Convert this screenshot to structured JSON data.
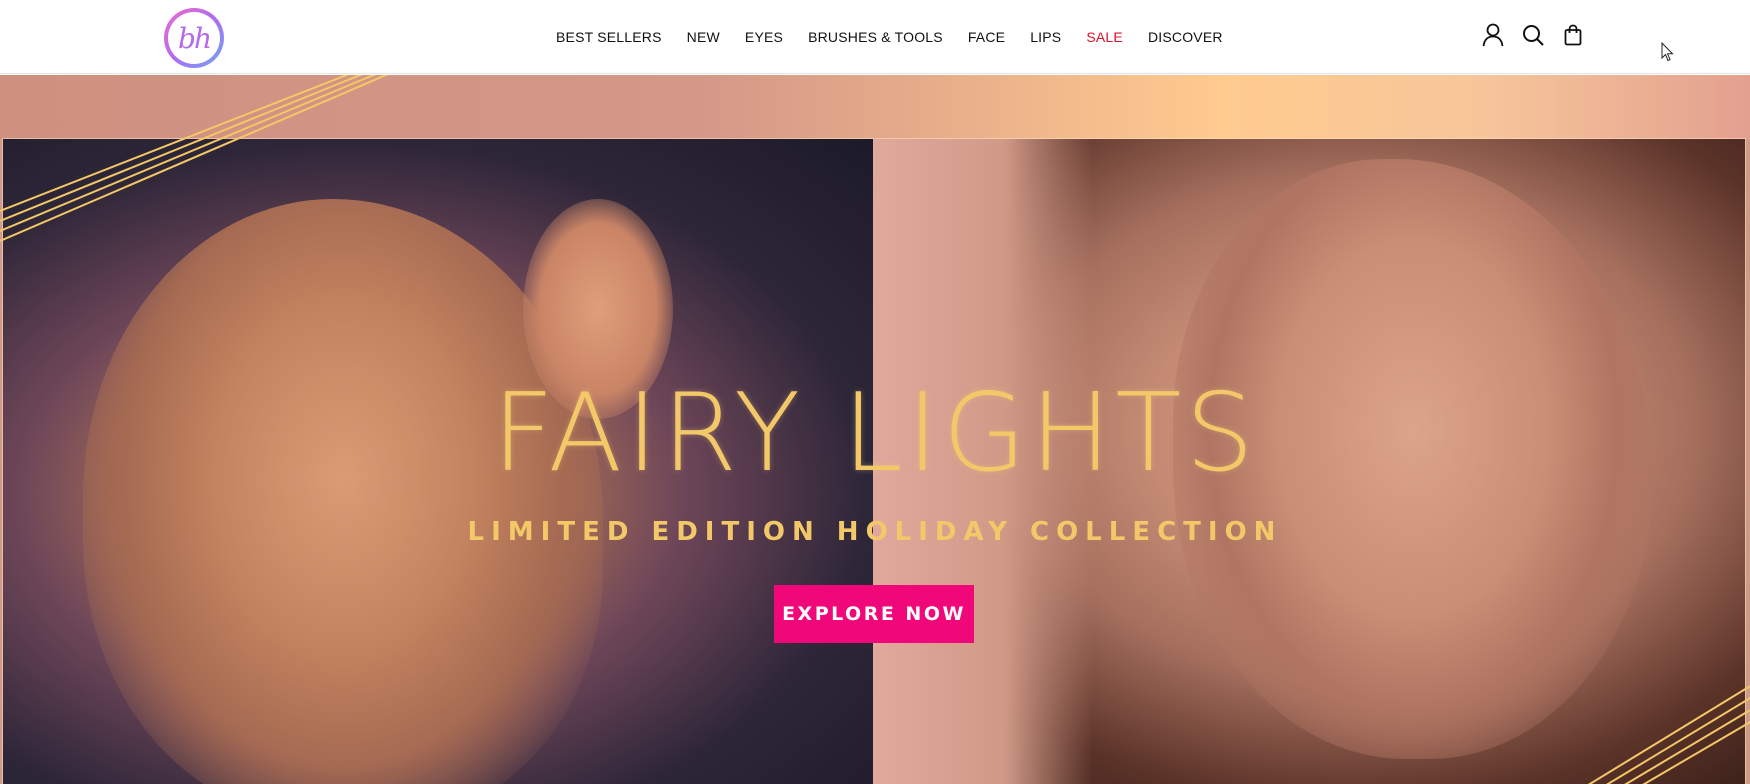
{
  "header": {
    "logo_text": "bh",
    "nav": [
      {
        "label": "BEST SELLERS"
      },
      {
        "label": "NEW"
      },
      {
        "label": "EYES"
      },
      {
        "label": "BRUSHES & TOOLS"
      },
      {
        "label": "FACE"
      },
      {
        "label": "LIPS"
      },
      {
        "label": "SALE"
      },
      {
        "label": "DISCOVER"
      }
    ],
    "icons": [
      "account-icon",
      "search-icon",
      "shopping-bag-icon"
    ]
  },
  "hero": {
    "title": "FAIRY LIGHTS",
    "subtitle": "LIMITED EDITION HOLIDAY COLLECTION",
    "cta_label": "EXPLORE NOW"
  },
  "colors": {
    "accent_gold": "#f2c869",
    "cta_pink": "#f0077a",
    "sale_red": "#e0102b"
  }
}
